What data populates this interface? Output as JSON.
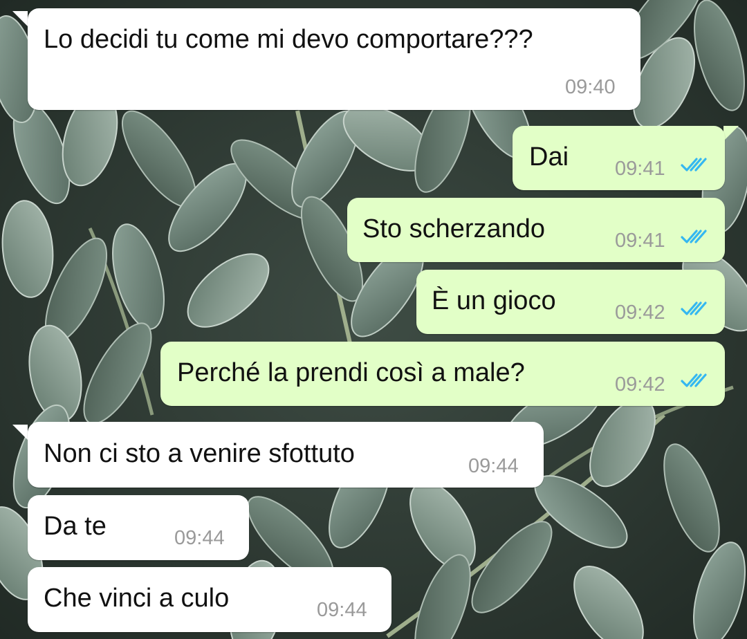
{
  "colors": {
    "incoming_bubble": "#ffffff",
    "outgoing_bubble": "#e2ffc7",
    "timestamp": "#9a9a9a",
    "read_ticks": "#34b7f1",
    "text": "#111111"
  },
  "messages": [
    {
      "direction": "incoming",
      "text": "Lo decidi tu come mi devo comportare???",
      "time": "09:40"
    },
    {
      "direction": "outgoing",
      "text": "Dai",
      "time": "09:41",
      "status": "read"
    },
    {
      "direction": "outgoing",
      "text": "Sto scherzando",
      "time": "09:41",
      "status": "read"
    },
    {
      "direction": "outgoing",
      "text": "È un gioco",
      "time": "09:42",
      "status": "read"
    },
    {
      "direction": "outgoing",
      "text": "Perché la prendi così a male?",
      "time": "09:42",
      "status": "read"
    },
    {
      "direction": "incoming",
      "text": "Non ci sto a venire sfottuto",
      "time": "09:44"
    },
    {
      "direction": "incoming",
      "text": "Da te",
      "time": "09:44"
    },
    {
      "direction": "incoming",
      "text": "Che vinci a culo",
      "time": "09:44"
    }
  ]
}
